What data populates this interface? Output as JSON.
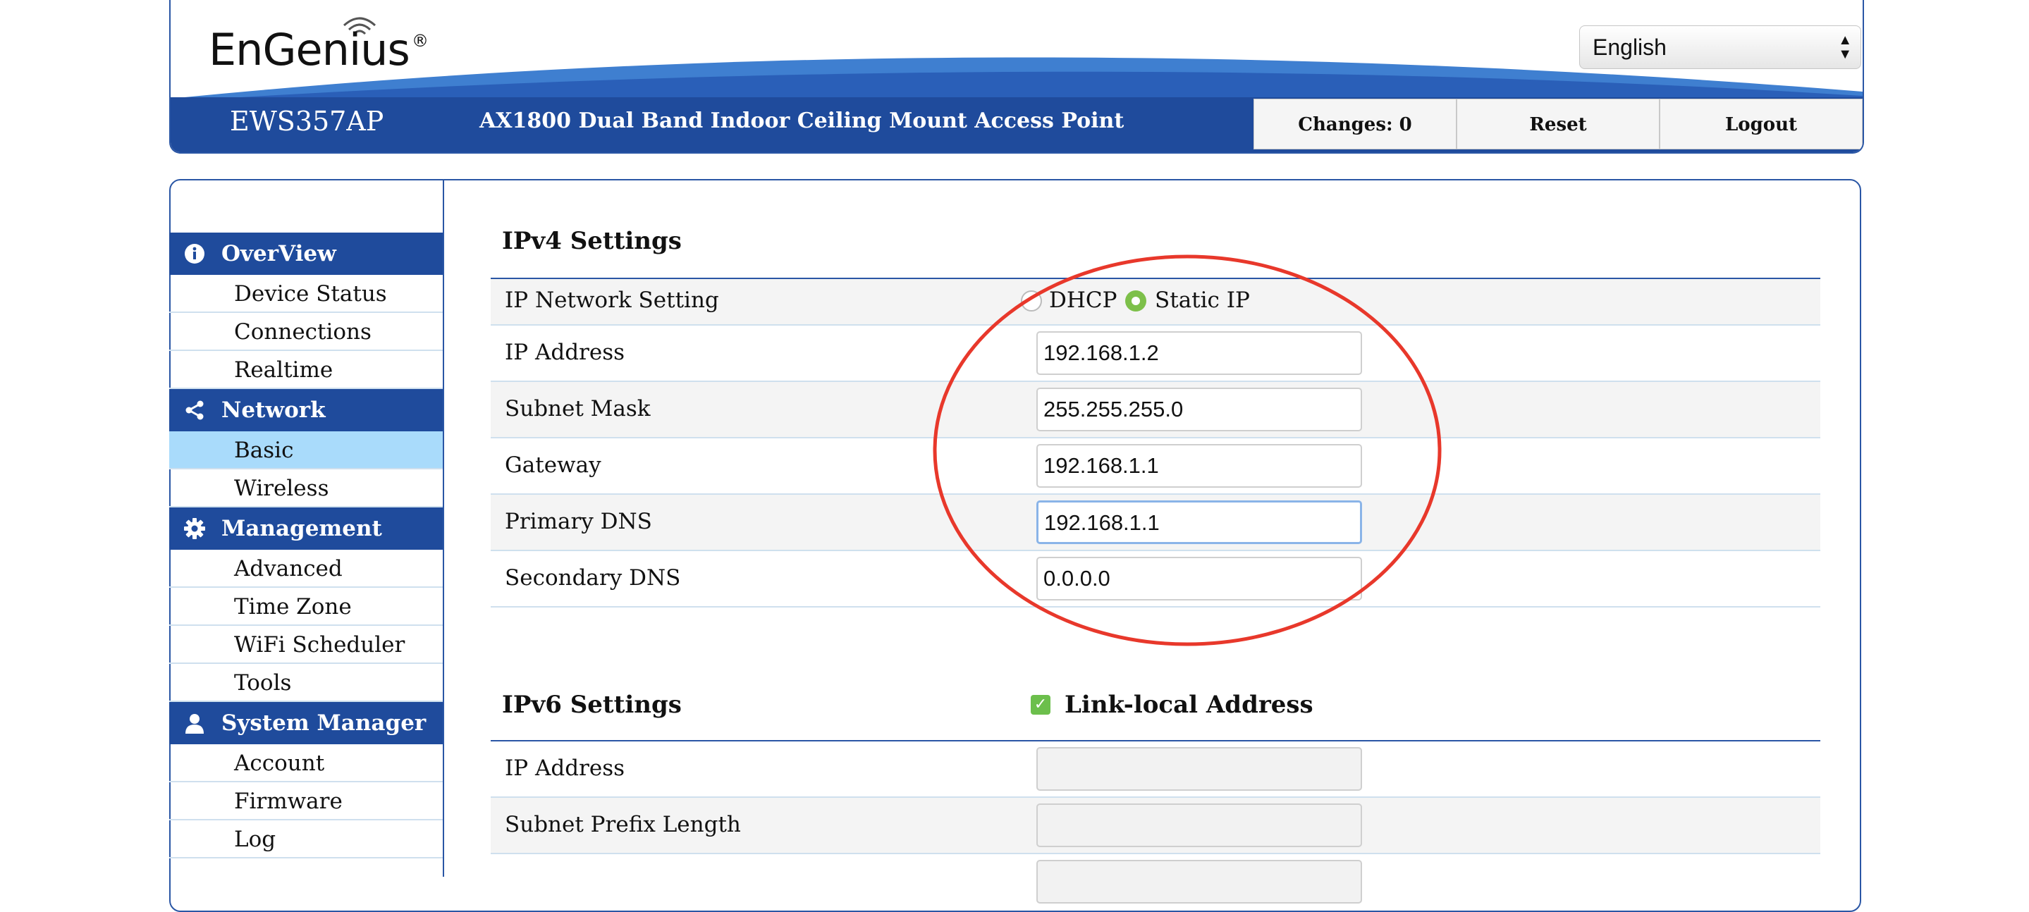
{
  "header": {
    "logo": "EnGenius",
    "logo_mark": "®",
    "model": "EWS357AP",
    "product": "AX1800 Dual Band Indoor Ceiling Mount Access Point",
    "changes": "Changes: 0",
    "reset": "Reset",
    "logout": "Logout",
    "language": "English"
  },
  "sidebar": {
    "overview": {
      "label": "OverView",
      "items": [
        "Device Status",
        "Connections",
        "Realtime"
      ]
    },
    "network": {
      "label": "Network",
      "items": [
        "Basic",
        "Wireless"
      ]
    },
    "management": {
      "label": "Management",
      "items": [
        "Advanced",
        "Time Zone",
        "WiFi Scheduler",
        "Tools"
      ]
    },
    "system": {
      "label": "System Manager",
      "items": [
        "Account",
        "Firmware",
        "Log"
      ]
    }
  },
  "ipv4": {
    "title": "IPv4 Settings",
    "network_setting_label": "IP Network Setting",
    "dhcp": "DHCP",
    "static": "Static IP",
    "ip_label": "IP Address",
    "ip": "192.168.1.2",
    "mask_label": "Subnet Mask",
    "mask": "255.255.255.0",
    "gateway_label": "Gateway",
    "gateway": "192.168.1.1",
    "pdns_label": "Primary DNS",
    "pdns": "192.168.1.1",
    "sdns_label": "Secondary DNS",
    "sdns": "0.0.0.0"
  },
  "ipv6": {
    "title": "IPv6 Settings",
    "link_local": "Link-local Address",
    "ip_label": "IP Address",
    "prefix_label": "Subnet Prefix Length"
  },
  "colors": {
    "brand_blue": "#1f4b9c",
    "active_item": "#a9dbfb",
    "annotation_red": "#e8382b",
    "radio_green": "#7dc04a"
  }
}
